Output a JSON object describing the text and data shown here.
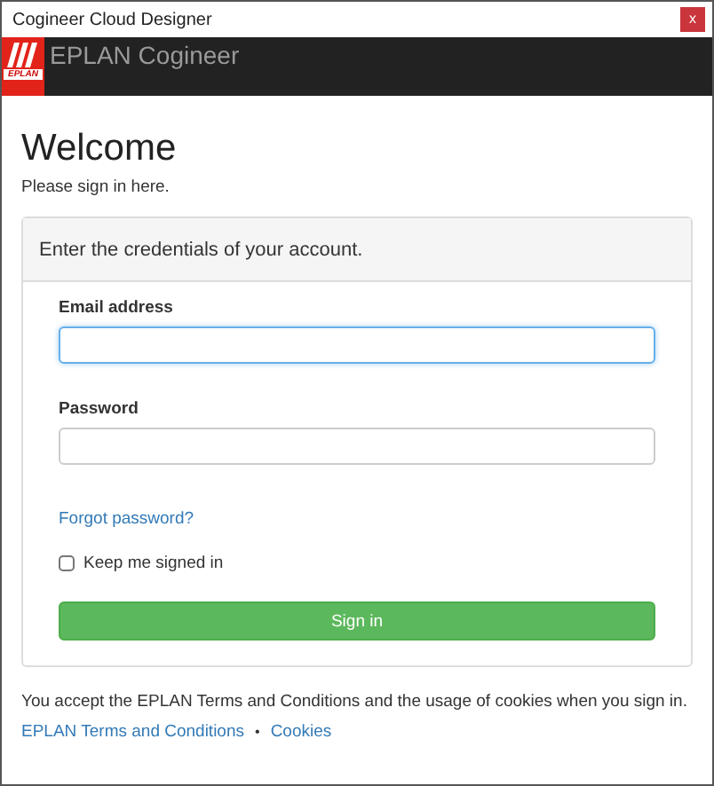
{
  "window": {
    "title": "Cogineer Cloud Designer",
    "close": "x"
  },
  "header": {
    "logo_text": "EPLAN",
    "title": "EPLAN Cogineer"
  },
  "heading": "Welcome",
  "subheading": "Please sign in here.",
  "panel": {
    "title": "Enter the credentials of your account.",
    "fields": [
      {
        "label": "Email address",
        "focused": true
      },
      {
        "label": "Password",
        "focused": false
      }
    ],
    "forgot_link": "Forgot password?",
    "remember": {
      "label": "Keep me signed in",
      "checked": false
    },
    "submit": "Sign in"
  },
  "footer": {
    "text": "You accept the EPLAN Terms and Conditions and the usage of cookies when you sign in.",
    "links": [
      "EPLAN Terms and Conditions",
      "Cookies"
    ],
    "separator": "•"
  }
}
